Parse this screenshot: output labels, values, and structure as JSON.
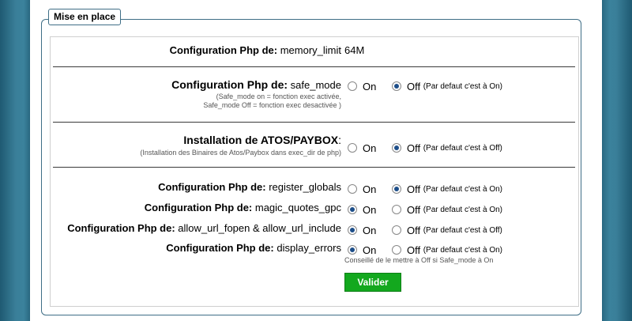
{
  "legend": "Mise en place",
  "memory": {
    "prefix": "Configuration Php de:",
    "key": " memory_limit",
    "value": "64M"
  },
  "safe_mode": {
    "prefix": "Configuration Php de:",
    "key": " safe_mode",
    "note1": "(Safe_mode on = fonction exec activée,",
    "note2": "Safe_mode Off = fonction exec desactivée )",
    "on_label": "On",
    "off_label": "Off",
    "default_text": "(Par defaut c'est à On)",
    "selected": "Off"
  },
  "atos": {
    "label": "Installation de ATOS/PAYBOX",
    "colon": ":",
    "note": "(Installation des Binaires de Atos/Paybox dans exec_dir de php)",
    "on_label": "On",
    "off_label": "Off",
    "default_text": "(Par defaut c'est à Off)",
    "selected": "Off"
  },
  "settings": [
    {
      "prefix": "Configuration Php de:",
      "key": " register_globals",
      "on_label": "On",
      "off_label": "Off",
      "default_text": "(Par defaut c'est à On)",
      "selected": "Off"
    },
    {
      "prefix": "Configuration Php de:",
      "key": " magic_quotes_gpc",
      "on_label": "On",
      "off_label": "Off",
      "default_text": "(Par defaut c'est à On)",
      "selected": "On"
    },
    {
      "prefix": "Configuration Php de:",
      "key": " allow_url_fopen & allow_url_include",
      "on_label": "On",
      "off_label": "Off",
      "default_text": "(Par defaut c'est à Off)",
      "selected": "On"
    },
    {
      "prefix": "Configuration Php de:",
      "key": " display_errors",
      "on_label": "On",
      "off_label": "Off",
      "default_text": "(Par defaut c'est à On)",
      "selected": "On"
    }
  ],
  "advice": "Conseillé de le mettre à Off si Safe_mode à On",
  "submit_label": "Valider",
  "colors": {
    "accent_button": "#13a81e",
    "radio_dot": "#1d4e89",
    "border": "#3f6e86"
  }
}
